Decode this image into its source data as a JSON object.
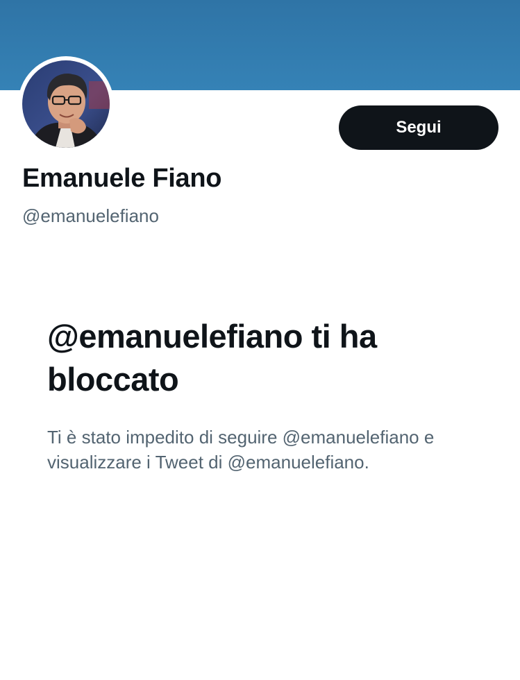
{
  "profile": {
    "display_name": "Emanuele Fiano",
    "handle": "@emanuelefiano",
    "avatar_alt": "Emanuele Fiano",
    "follow_label": "Segui"
  },
  "blocked": {
    "title": "@emanuelefiano ti ha bloccato",
    "message": "Ti è stato impedito di seguire @emanuelefiano e visualizzare i Tweet di @emanuelefiano."
  },
  "colors": {
    "banner": "#3582b6",
    "button": "#0f1419",
    "secondary_text": "#536471"
  }
}
